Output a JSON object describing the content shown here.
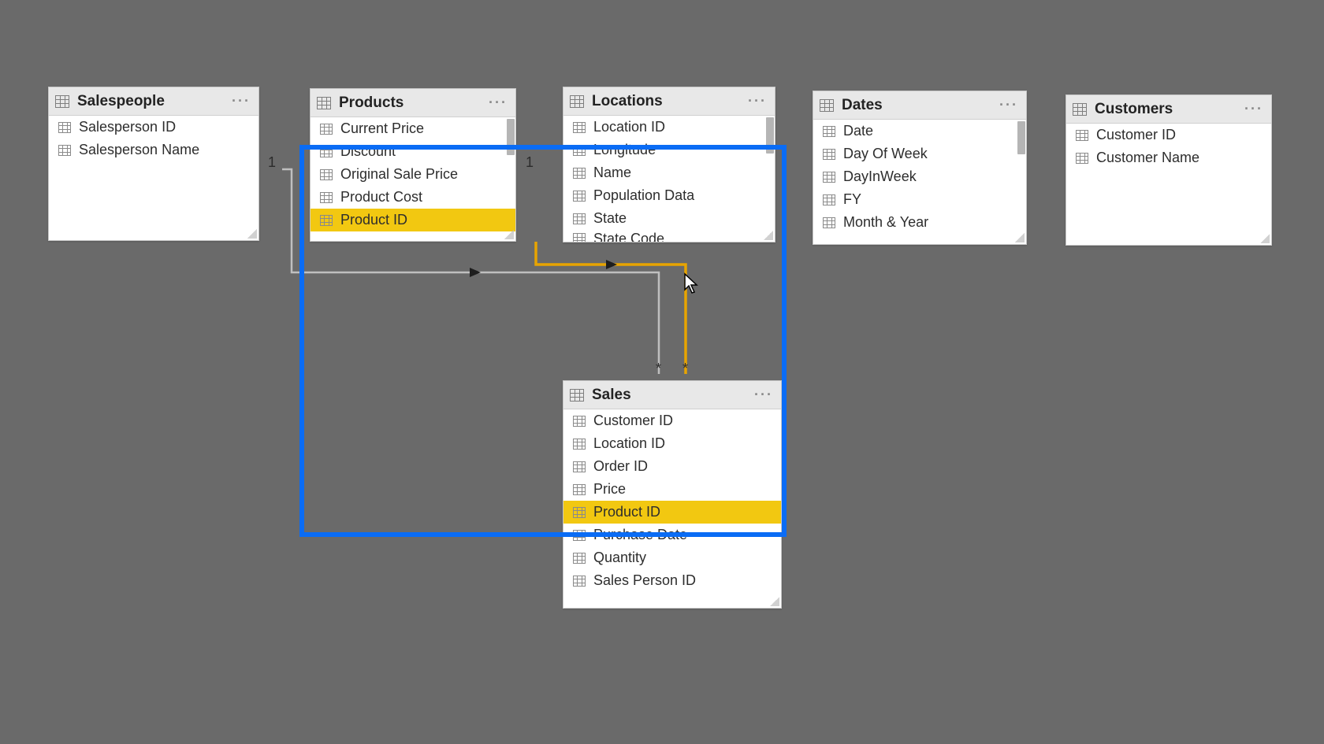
{
  "tables": {
    "salespeople": {
      "title": "Salespeople",
      "fields": [
        "Salesperson ID",
        "Salesperson Name"
      ]
    },
    "products": {
      "title": "Products",
      "fields": [
        "Current Price",
        "Discount",
        "Original Sale Price",
        "Product Cost",
        "Product ID"
      ],
      "highlightedField": "Product ID"
    },
    "locations": {
      "title": "Locations",
      "fields": [
        "Location ID",
        "Longitude",
        "Name",
        "Population Data",
        "State",
        "State Code"
      ]
    },
    "dates": {
      "title": "Dates",
      "fields": [
        "Date",
        "Day Of Week",
        "DayInWeek",
        "FY",
        "Month & Year"
      ]
    },
    "customers": {
      "title": "Customers",
      "fields": [
        "Customer ID",
        "Customer Name"
      ]
    },
    "sales": {
      "title": "Sales",
      "fields": [
        "Customer ID",
        "Location ID",
        "Order ID",
        "Price",
        "Product ID",
        "Purchase Date",
        "Quantity",
        "Sales Person ID"
      ],
      "highlightedField": "Product ID"
    }
  },
  "cardinalityLabels": {
    "products_one": "1",
    "locations_one": "1",
    "sales_many1": "*",
    "sales_many2": "*"
  },
  "icons": {
    "table": "table-icon",
    "field": "field-icon",
    "menu": "ellipsis-icon"
  },
  "menuGlyph": "···"
}
